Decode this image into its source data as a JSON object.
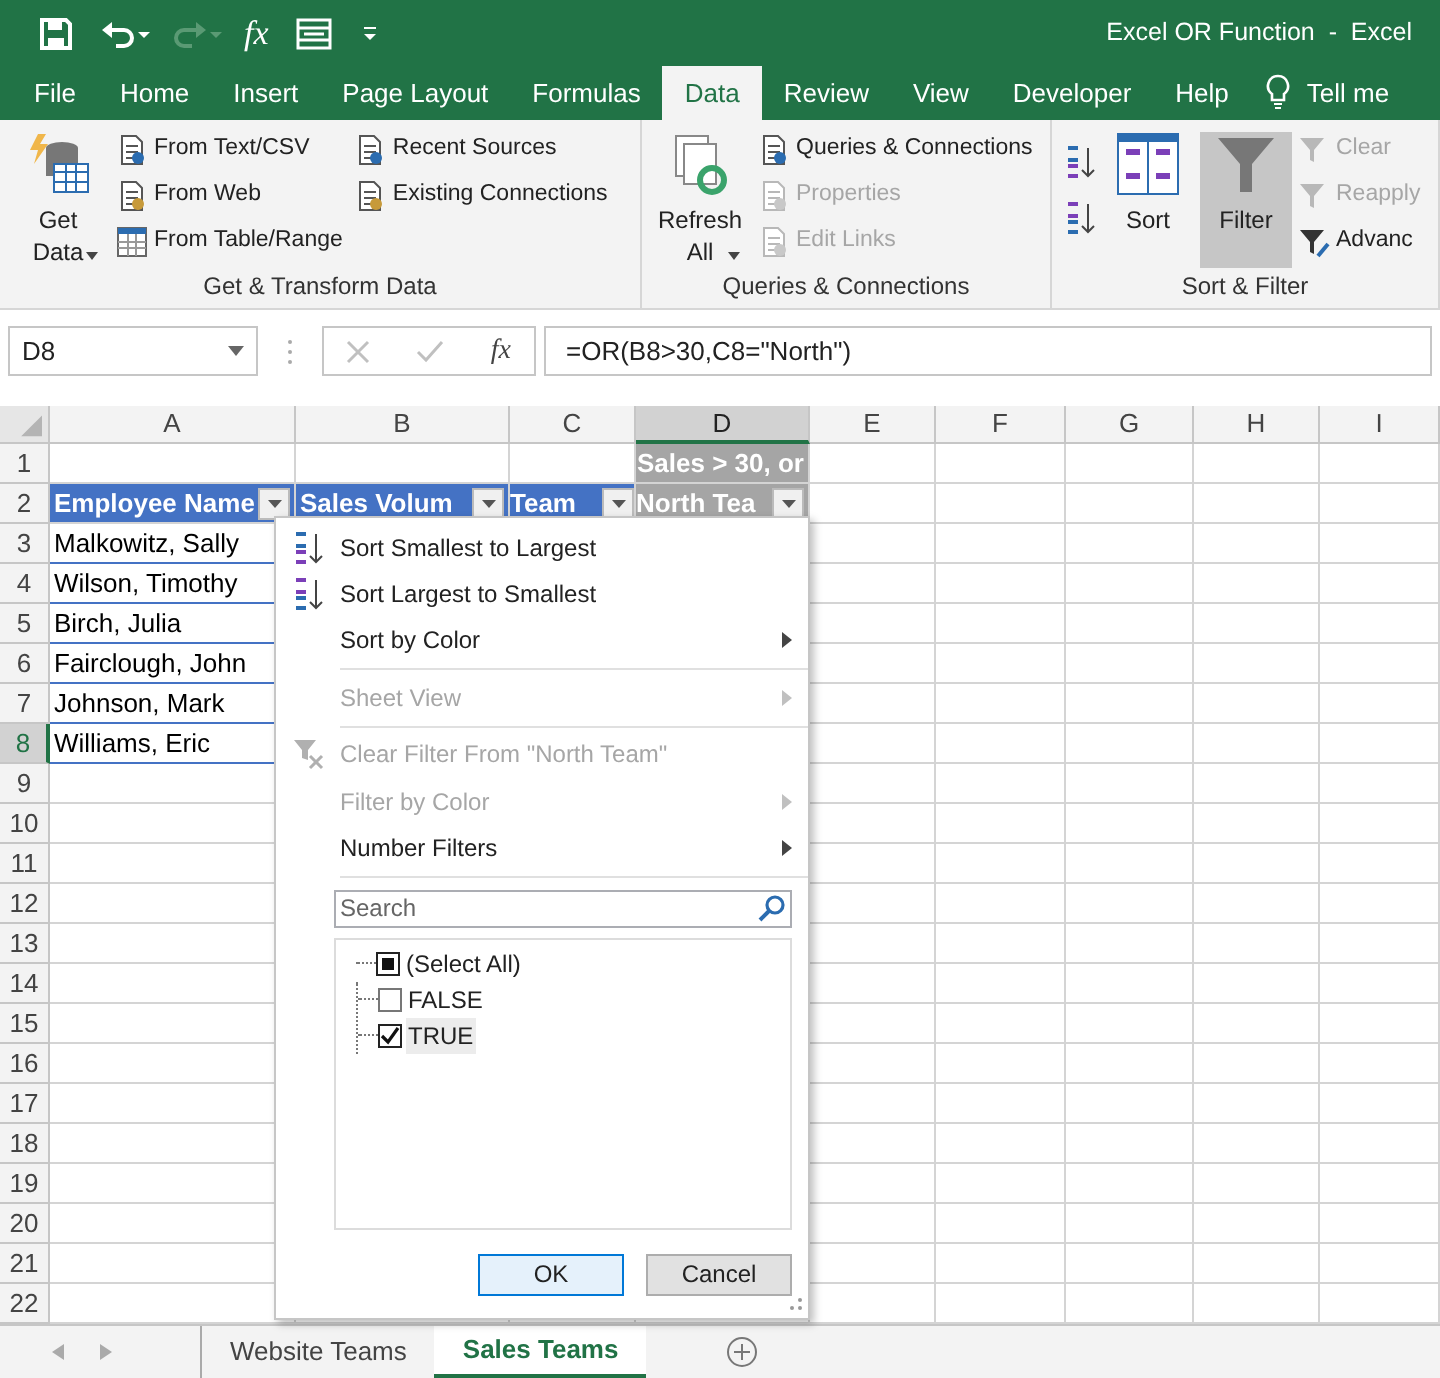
{
  "window": {
    "title": "Excel OR Function  -  Excel"
  },
  "quick_access": {
    "function_label": "fx"
  },
  "ribbon_tabs": [
    {
      "label": "File",
      "selected": false
    },
    {
      "label": "Home",
      "selected": false
    },
    {
      "label": "Insert",
      "selected": false
    },
    {
      "label": "Page Layout",
      "selected": false
    },
    {
      "label": "Formulas",
      "selected": false
    },
    {
      "label": "Data",
      "selected": true
    },
    {
      "label": "Review",
      "selected": false
    },
    {
      "label": "View",
      "selected": false
    },
    {
      "label": "Developer",
      "selected": false
    },
    {
      "label": "Help",
      "selected": false
    }
  ],
  "tell_me": "Tell me",
  "ribbon_groups": [
    {
      "label": "Get & Transform Data",
      "parts": [
        {
          "kind": "large",
          "label": "Get Data",
          "caret": true,
          "selected": false
        },
        {
          "kind": "column",
          "items": [
            {
              "label": "From Text/CSV",
              "disabled": false
            },
            {
              "label": "From Web",
              "disabled": false
            },
            {
              "label": "From Table/Range",
              "disabled": false
            }
          ]
        },
        {
          "kind": "column",
          "items": [
            {
              "label": "Recent Sources",
              "disabled": false
            },
            {
              "label": "Existing Connections",
              "disabled": false
            }
          ]
        }
      ]
    },
    {
      "label": "Queries & Connections",
      "parts": [
        {
          "kind": "large",
          "label": "Refresh All",
          "caret": true,
          "selected": false
        },
        {
          "kind": "column",
          "items": [
            {
              "label": "Queries & Connections",
              "disabled": false
            },
            {
              "label": "Properties",
              "disabled": true
            },
            {
              "label": "Edit Links",
              "disabled": true
            }
          ]
        }
      ]
    },
    {
      "label": "Sort & Filter",
      "parts": [
        {
          "kind": "sort_icons"
        },
        {
          "kind": "large",
          "label": "Sort",
          "caret": false,
          "selected": false
        },
        {
          "kind": "large",
          "label": "Filter",
          "caret": false,
          "selected": true
        },
        {
          "kind": "column",
          "items": [
            {
              "label": "Clear",
              "disabled": true
            },
            {
              "label": "Reapply",
              "disabled": true
            },
            {
              "label": "Advanc",
              "disabled": false
            }
          ]
        }
      ]
    }
  ],
  "formula_bar": {
    "name_box": "D8",
    "function_label": "fx",
    "formula": "=OR(B8>30,C8=\"North\")"
  },
  "sheet": {
    "columns": [
      {
        "label": "A",
        "selected": false
      },
      {
        "label": "B",
        "selected": false
      },
      {
        "label": "C",
        "selected": false
      },
      {
        "label": "D",
        "selected": true
      },
      {
        "label": "E",
        "selected": false
      },
      {
        "label": "F",
        "selected": false
      },
      {
        "label": "G",
        "selected": false
      },
      {
        "label": "H",
        "selected": false
      },
      {
        "label": "I",
        "selected": false
      }
    ],
    "rows": [
      {
        "number": "1",
        "selected": false,
        "cells": [
          null,
          null,
          null,
          {
            "text": "Sales > 30, or",
            "kind": "grey_header",
            "filter": false
          }
        ]
      },
      {
        "number": "2",
        "selected": false,
        "cells": [
          {
            "text": "Employee Name",
            "kind": "blue_header",
            "filter": true
          },
          {
            "text": "Sales Volum",
            "kind": "blue_header",
            "filter": true
          },
          {
            "text": "Team",
            "kind": "blue_header_right",
            "filter": true
          },
          {
            "text": "North Tea",
            "kind": "grey_header",
            "filter": true
          }
        ]
      },
      {
        "number": "3",
        "selected": false,
        "cells": [
          {
            "text": "Malkowitz, Sally",
            "kind": "table",
            "filter": false
          }
        ]
      },
      {
        "number": "4",
        "selected": false,
        "cells": [
          {
            "text": "Wilson, Timothy",
            "kind": "table",
            "filter": false
          }
        ]
      },
      {
        "number": "5",
        "selected": false,
        "cells": [
          {
            "text": "Birch, Julia",
            "kind": "table",
            "filter": false
          }
        ]
      },
      {
        "number": "6",
        "selected": false,
        "cells": [
          {
            "text": "Fairclough, John",
            "kind": "table",
            "filter": false
          }
        ]
      },
      {
        "number": "7",
        "selected": false,
        "cells": [
          {
            "text": "Johnson, Mark",
            "kind": "table",
            "filter": false
          }
        ]
      },
      {
        "number": "8",
        "selected": true,
        "cells": [
          {
            "text": "Williams, Eric",
            "kind": "table",
            "filter": false
          }
        ]
      },
      {
        "number": "9",
        "selected": false
      },
      {
        "number": "10",
        "selected": false
      },
      {
        "number": "11",
        "selected": false
      },
      {
        "number": "12",
        "selected": false
      },
      {
        "number": "13",
        "selected": false
      },
      {
        "number": "14",
        "selected": false
      },
      {
        "number": "15",
        "selected": false
      },
      {
        "number": "16",
        "selected": false
      },
      {
        "number": "17",
        "selected": false
      },
      {
        "number": "18",
        "selected": false
      },
      {
        "number": "19",
        "selected": false
      },
      {
        "number": "20",
        "selected": false
      },
      {
        "number": "21",
        "selected": false
      },
      {
        "number": "22",
        "selected": false
      }
    ]
  },
  "filter_menu": {
    "items": [
      {
        "label": "Sort Smallest to Largest",
        "kind": "sort_ascending",
        "disabled": false,
        "submenu": false,
        "separator_after": false
      },
      {
        "label": "Sort Largest to Smallest",
        "kind": "sort_descending",
        "disabled": false,
        "submenu": false,
        "separator_after": false
      },
      {
        "label": "Sort by Color",
        "kind": "plain",
        "disabled": false,
        "submenu": true,
        "separator_after": true
      },
      {
        "label": "Sheet View",
        "kind": "plain",
        "disabled": true,
        "submenu": true,
        "separator_after": true
      },
      {
        "label": "Clear Filter From \"North Team\"",
        "kind": "clear_filter",
        "disabled": true,
        "submenu": false,
        "separator_after": false
      },
      {
        "label": "Filter by Color",
        "kind": "plain",
        "disabled": true,
        "submenu": true,
        "separator_after": false
      },
      {
        "label": "Number Filters",
        "kind": "plain",
        "disabled": false,
        "submenu": true,
        "separator_after": true
      }
    ],
    "search": {
      "placeholder": "Search"
    },
    "values": [
      {
        "label": "(Select All)",
        "checked": true,
        "indeterminate": true,
        "selected": false,
        "children": [
          {
            "label": "FALSE",
            "checked": false,
            "indeterminate": false,
            "selected": false
          },
          {
            "label": "TRUE",
            "checked": true,
            "indeterminate": false,
            "selected": true
          }
        ]
      }
    ],
    "buttons": [
      {
        "label": "OK",
        "default": true
      },
      {
        "label": "Cancel",
        "default": false
      }
    ]
  },
  "sheet_tabs": [
    {
      "label": "Website Teams",
      "selected": false
    },
    {
      "label": "Sales Teams",
      "selected": true
    }
  ]
}
